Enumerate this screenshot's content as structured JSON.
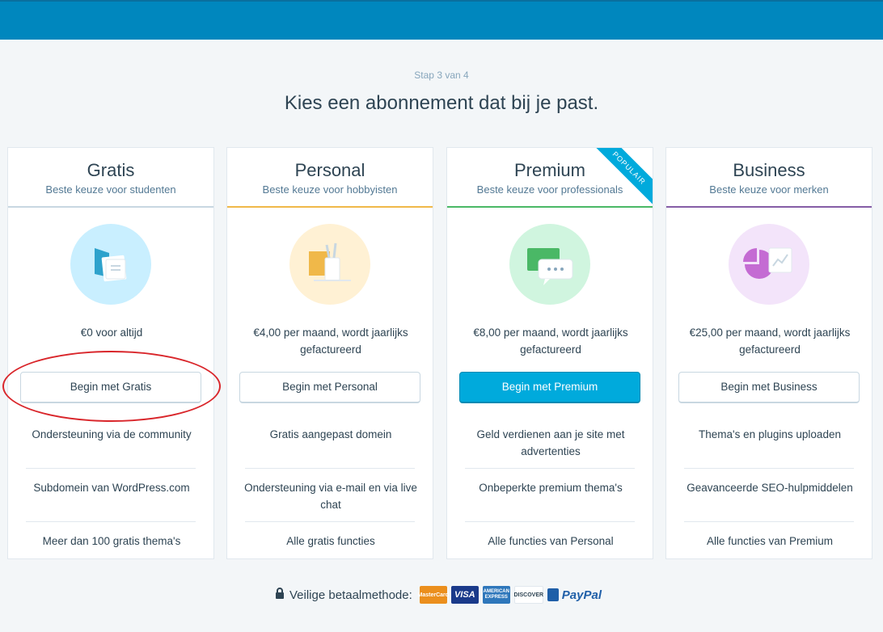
{
  "header": {
    "step": "Stap 3 van 4",
    "title": "Kies een abonnement dat bij je past."
  },
  "colors": {
    "topbar": "#0087be",
    "primary_button": "#00aadc",
    "gratis": "#c8d7e1",
    "personal": "#f0b849",
    "premium": "#4ab866",
    "business": "#855da6",
    "annotation": "#d9262b"
  },
  "plans": [
    {
      "name": "Gratis",
      "tagline": "Beste keuze voor studenten",
      "icon": "documents-icon",
      "price": "€0 voor altijd",
      "button": "Begin met Gratis",
      "features": [
        "Ondersteuning via de community",
        "Subdomein van WordPress.com",
        "Meer dan 100 gratis thema's"
      ]
    },
    {
      "name": "Personal",
      "tagline": "Beste keuze voor hobbyisten",
      "icon": "pencil-cup-icon",
      "price": "€4,00 per maand, wordt jaarlijks gefactureerd",
      "button": "Begin met Personal",
      "features": [
        "Gratis aangepast domein",
        "Ondersteuning via e-mail en via live chat",
        "Alle gratis functies"
      ]
    },
    {
      "name": "Premium",
      "tagline": "Beste keuze voor professionals",
      "icon": "chat-screen-icon",
      "ribbon": "POPULAIR",
      "price": "€8,00 per maand, wordt jaarlijks gefactureerd",
      "button": "Begin met Premium",
      "features": [
        "Geld verdienen aan je site met advertenties",
        "Onbeperkte premium thema's",
        "Alle functies van Personal"
      ]
    },
    {
      "name": "Business",
      "tagline": "Beste keuze voor merken",
      "icon": "pie-chart-icon",
      "price": "€25,00 per maand, wordt jaarlijks gefactureerd",
      "button": "Begin met Business",
      "features": [
        "Thema's en plugins uploaden",
        "Geavanceerde SEO-hulpmiddelen",
        "Alle functies van Premium"
      ]
    }
  ],
  "payment": {
    "label": "Veilige betaalmethode:",
    "methods": [
      "MasterCard",
      "VISA",
      "AMERICAN EXPRESS",
      "DISCOVER",
      "PayPal"
    ]
  }
}
